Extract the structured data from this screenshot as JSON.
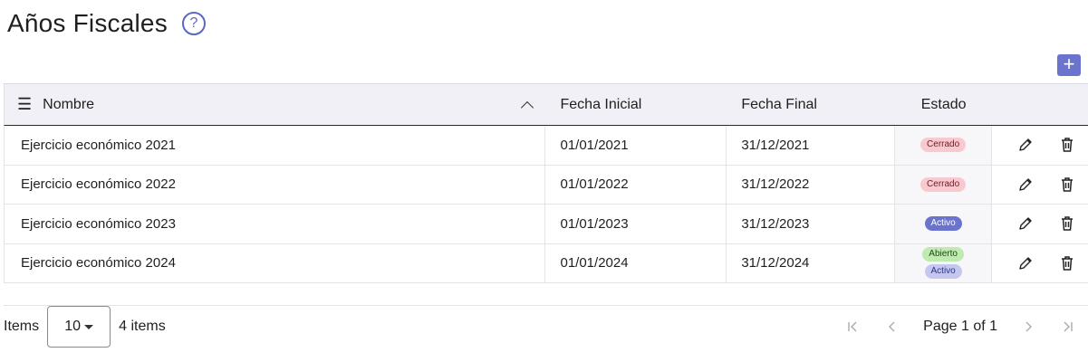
{
  "page": {
    "title": "Años Fiscales",
    "help_icon": "question-circle-icon"
  },
  "toolbar": {
    "add_label": "+",
    "add_icon": "plus-icon",
    "accent": "#6a74cc"
  },
  "table": {
    "columns": [
      {
        "label": "Nombre",
        "menu_icon": "hamburger-menu-icon",
        "sort_icon": "chevron-up-icon"
      },
      {
        "label": "Fecha Inicial"
      },
      {
        "label": "Fecha Final"
      },
      {
        "label": "Estado"
      }
    ],
    "rows": [
      {
        "nombre": "Ejercicio económico 2021",
        "fecha_inicial": "01/01/2021",
        "fecha_final": "31/12/2021",
        "estado": [
          "Cerrado"
        ]
      },
      {
        "nombre": "Ejercicio económico 2022",
        "fecha_inicial": "01/01/2022",
        "fecha_final": "31/12/2022",
        "estado": [
          "Cerrado"
        ]
      },
      {
        "nombre": "Ejercicio económico 2023",
        "fecha_inicial": "01/01/2023",
        "fecha_final": "31/12/2023",
        "estado": [
          "Activo"
        ]
      },
      {
        "nombre": "Ejercicio económico 2024",
        "fecha_inicial": "01/01/2024",
        "fecha_final": "31/12/2024",
        "estado": [
          "Abierto",
          "Activo"
        ]
      }
    ],
    "row_actions": {
      "edit_icon": "pencil-icon",
      "delete_icon": "trash-icon"
    },
    "status_colors": {
      "Cerrado": "#f8c9cf",
      "Activo": "#6a74cc",
      "Abierto": "#bfeab0"
    }
  },
  "pager": {
    "items_label": "Items",
    "page_size": "10",
    "count_text": "4 items",
    "page_text": "Page 1 of 1",
    "first_icon": "first-page-icon",
    "prev_icon": "chevron-left-icon",
    "next_icon": "chevron-right-icon",
    "last_icon": "last-page-icon"
  }
}
